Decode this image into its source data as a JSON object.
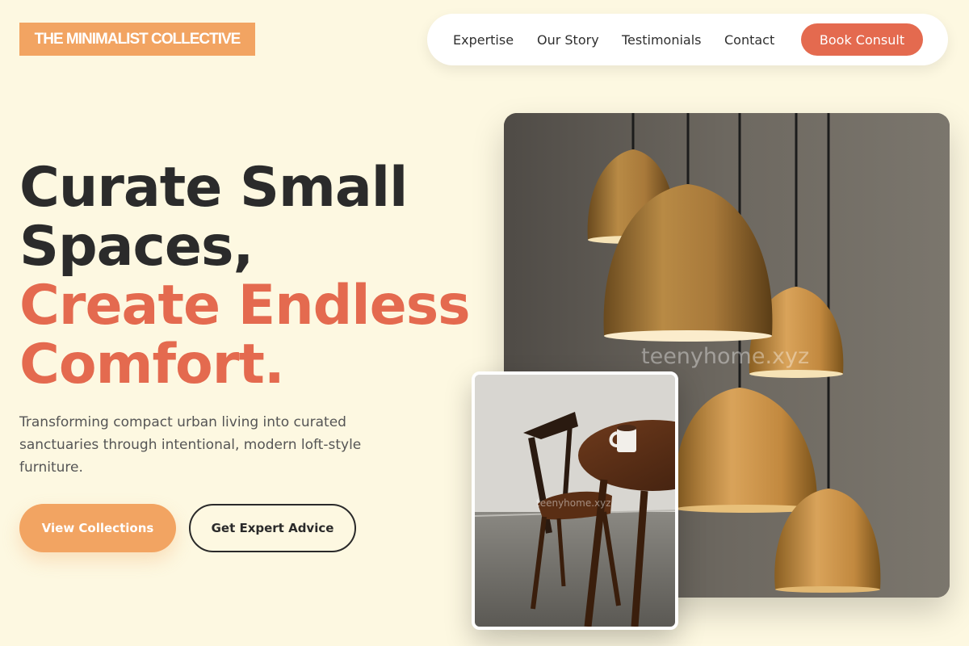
{
  "brand": {
    "name": "THE MINIMALIST COLLECTIVE",
    "color": "#f2a462"
  },
  "nav": {
    "links": [
      "Expertise",
      "Our Story",
      "Testimonials",
      "Contact"
    ],
    "cta_label": "Book Consult",
    "cta_color": "#e46a4f"
  },
  "hero": {
    "title_dark": [
      "Curate Small",
      "Spaces,"
    ],
    "title_accent": [
      "Create Endless",
      "Comfort."
    ],
    "accent_color": "#e46a4f",
    "subtitle": "Transforming compact urban living into curated sanctuaries through intentional, modern loft-style furniture.",
    "primary_label": "View Collections",
    "secondary_label": "Get Expert Advice"
  },
  "images": {
    "main_photo": {
      "subject": "pendant-lamps",
      "watermark": "teenyhome.xyz"
    },
    "inset_photo": {
      "subject": "chair-and-table",
      "watermark": "teenyhome.xyz"
    }
  }
}
